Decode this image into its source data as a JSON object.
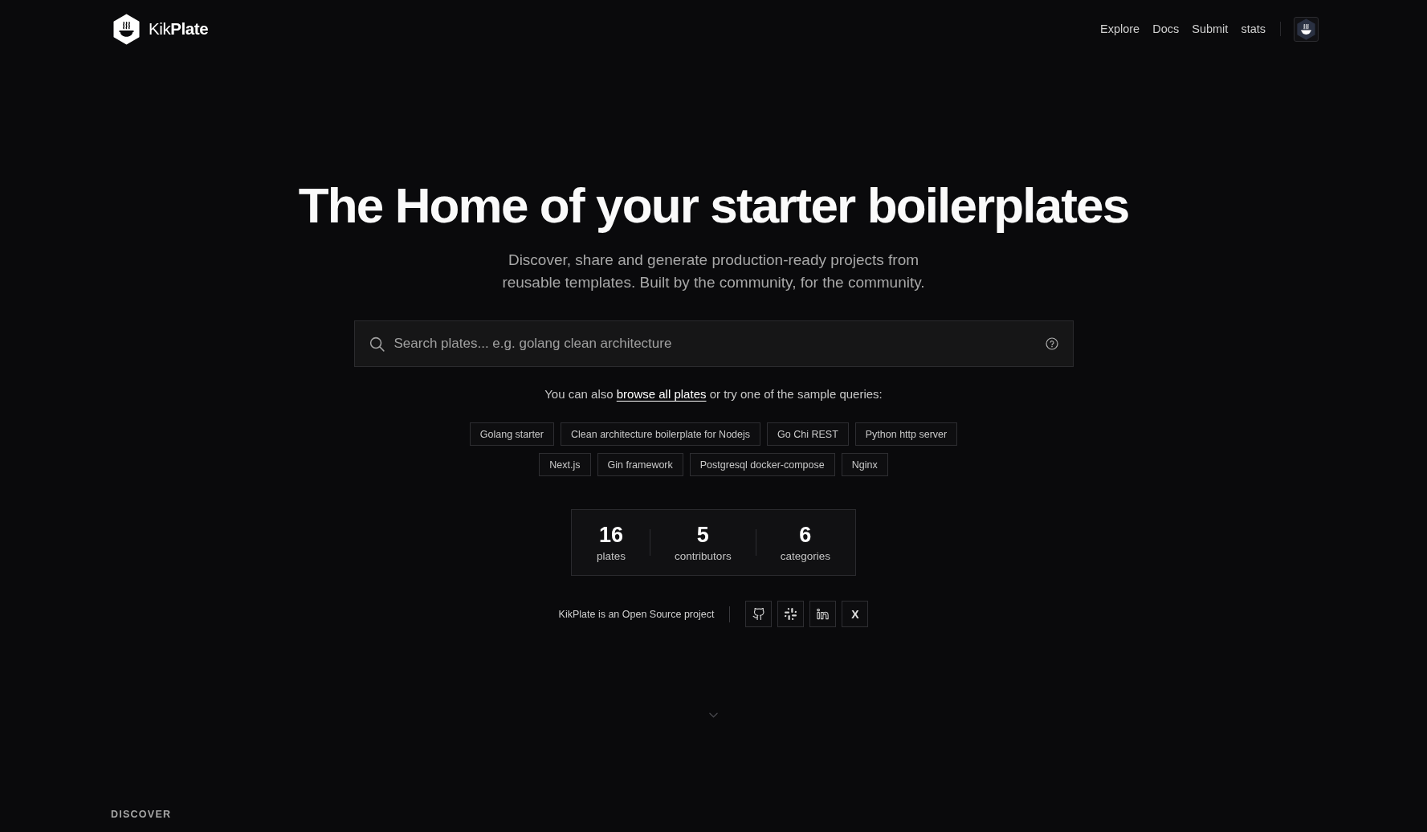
{
  "header": {
    "brand": "Kik**Plate**",
    "nav": [
      "Explore",
      "Docs",
      "Submit",
      "stats"
    ]
  },
  "hero": {
    "title": "The Home of your starter boilerplates",
    "subtitle": "Discover, share and generate production-ready projects from\nreusable templates. Built by the community, for the community."
  },
  "search": {
    "placeholder": "Search plates... e.g. golang clean architecture"
  },
  "browse_hint": {
    "before": "You can also",
    "link": "browse all plates",
    "after": "or try one of the sample queries:"
  },
  "sample_queries": [
    "Golang starter",
    "Clean architecture boilerplate for Nodejs",
    "Go Chi REST",
    "Python http server",
    "Next.js",
    "Gin framework",
    "Postgresql docker-compose",
    "Nginx"
  ],
  "stats": [
    {
      "value": "16",
      "label": "plates"
    },
    {
      "value": "5",
      "label": "contributors"
    },
    {
      "value": "6",
      "label": "categories"
    }
  ],
  "open_source": {
    "text": "KikPlate is an Open Source project",
    "links": [
      {
        "kind": "github"
      },
      {
        "kind": "slack"
      },
      {
        "kind": "linkedin"
      },
      {
        "kind": "letter",
        "label": "X"
      }
    ]
  },
  "section_label": "DISCOVER"
}
